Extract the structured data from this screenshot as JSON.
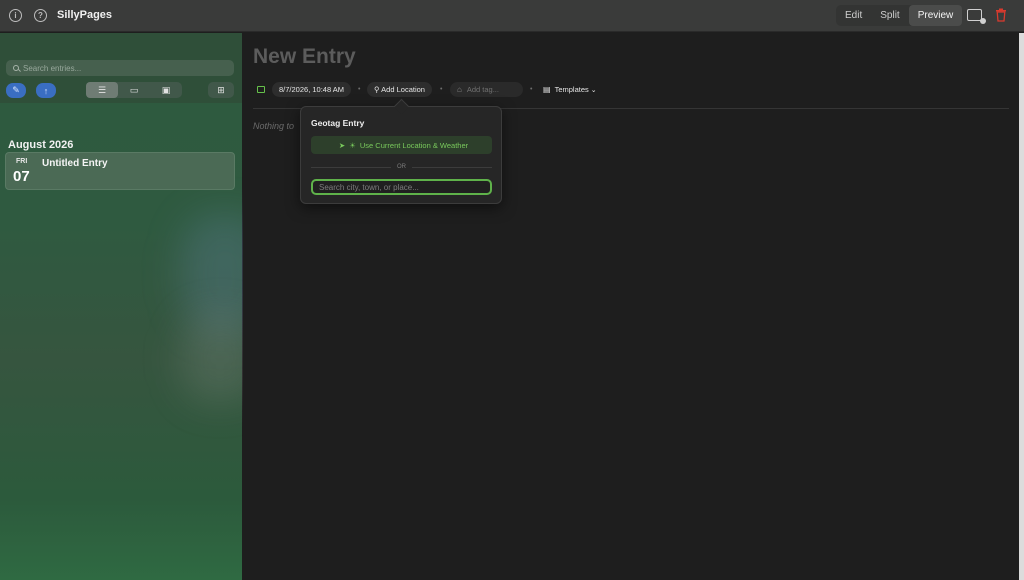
{
  "app": {
    "title": "SillyPages"
  },
  "toolbar": {
    "modes": [
      "Edit",
      "Split",
      "Preview"
    ],
    "active_mode": "Preview",
    "info_icon": "info-icon",
    "help_icon": "help-icon",
    "delete_color": "#d93a2e"
  },
  "sidebar": {
    "search_placeholder": "Search entries...",
    "month_header": "August 2026",
    "entries": [
      {
        "weekday": "FRI",
        "day": "07",
        "title": "Untitled Entry"
      }
    ]
  },
  "entry": {
    "title": "New Entry",
    "date": "8/7/2026, 10:48 AM",
    "add_location": "Add Location",
    "tag_placeholder": "Add tag...",
    "templates": "Templates",
    "body_placeholder": "Nothing to"
  },
  "popover": {
    "title": "Geotag Entry",
    "use_location": "Use Current Location & Weather",
    "or": "OR",
    "search_placeholder": "Search city, town, or place..."
  },
  "colors": {
    "accent_green": "#65c14a",
    "accent_blue": "#3a6ec2"
  }
}
